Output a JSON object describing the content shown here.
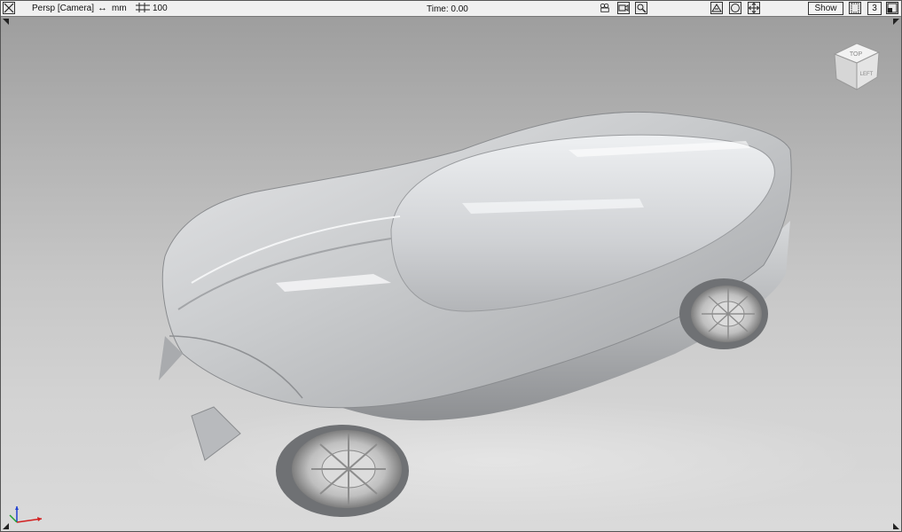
{
  "titlebar": {
    "view_label": "Persp [Camera]",
    "units_label": "mm",
    "grid_label": "100",
    "time_label": "Time: 0.00",
    "show_label": "Show",
    "count_label": "3"
  },
  "viewcube": {
    "top_label": "TOP",
    "left_label": "LEFT"
  },
  "axis_indicator": {
    "x_color": "#d22020",
    "y_color": "#20a030",
    "z_color": "#2040d0"
  },
  "icons": [
    "close-view-icon",
    "units-arrow-icon",
    "grid-size-icon",
    "camera-icon",
    "video-camera-icon",
    "zoom-icon",
    "perspective-toggle-icon",
    "circle-view-icon",
    "move-view-icon",
    "layout-icon",
    "maximize-icon"
  ],
  "model": {
    "subject": "concept sports car",
    "body_color": "#c4c6c8"
  }
}
